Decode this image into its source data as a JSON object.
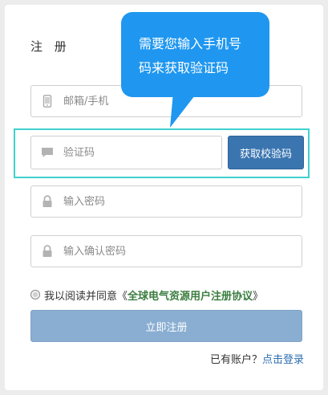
{
  "form": {
    "title": "注 册",
    "email": {
      "placeholder": "邮箱/手机",
      "icon": "phone-icon"
    },
    "code": {
      "placeholder": "验证码",
      "icon": "message-icon",
      "button_label": "获取校验码"
    },
    "password": {
      "placeholder": "输入密码",
      "icon": "lock-icon"
    },
    "confirm": {
      "placeholder": "输入确认密码",
      "icon": "lock-icon"
    },
    "agree": {
      "prefix": "我以阅读并同意",
      "open_bracket": "《",
      "link_text": "全球电气资源用户注册协议",
      "close_bracket": "》"
    },
    "submit_label": "立即注册",
    "login": {
      "prefix": "已有账户？",
      "link": "点击登录"
    }
  },
  "tooltip": {
    "line1": "需要您输入手机号",
    "line2": "码来获取验证码"
  },
  "colors": {
    "accent": "#3a75b0",
    "submit_bg": "#8aaed2",
    "highlight_border": "#3fd1cf",
    "tooltip_bg": "#1f97f0",
    "agreement_link": "#3a7d3e",
    "login_link": "#2d6fb0"
  }
}
